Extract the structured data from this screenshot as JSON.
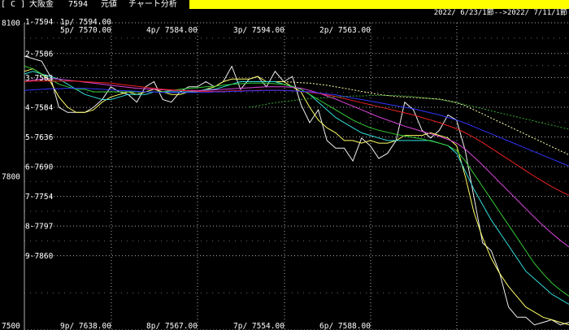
{
  "header": {
    "label_tag": "[ C ]",
    "market": "大阪金",
    "code": "7594",
    "price_type": "元値",
    "menu": "チャート分析"
  },
  "range_text": "2022/ 6/23/1節-->2022/ 7/11/1節",
  "colors": {
    "background": "#000000",
    "grid": "#b0b0b0",
    "highlight": "#ffff00",
    "text": "#ffffff"
  },
  "chart_data": {
    "type": "line",
    "x_count": 64,
    "ylim": [
      7500,
      8100
    ],
    "y_outer_labels": [
      {
        "label": "8100",
        "y": 8100
      },
      {
        "label": "7800",
        "y": 7800
      },
      {
        "label": "7500",
        "y": 7500
      }
    ],
    "y_inner_labels": [
      {
        "label": "1-7594",
        "y": 8100
      },
      {
        "label": "2-7586",
        "y": 8040
      },
      {
        "label": "3-7583",
        "y": 7993
      },
      {
        "label": "4-7584",
        "y": 7935
      },
      {
        "label": "5-7636",
        "y": 7877
      },
      {
        "label": "6-7690",
        "y": 7819
      },
      {
        "label": "7-7754",
        "y": 7761
      },
      {
        "label": "8-7797",
        "y": 7703
      },
      {
        "label": "9-7860",
        "y": 7645
      }
    ],
    "top_annotations": [
      {
        "label": "1p/ 7594.00",
        "row": 0,
        "col": 0
      },
      {
        "label": "5p/ 7570.00",
        "row": 1,
        "col": 0
      },
      {
        "label": "4p/ 7584.00",
        "row": 1,
        "col": 1
      },
      {
        "label": "3p/ 7594.00",
        "row": 1,
        "col": 2
      },
      {
        "label": "2p/ 7563.00",
        "row": 1,
        "col": 3
      }
    ],
    "bottom_annotations": [
      {
        "label": "9p/ 7638.00",
        "col": 0
      },
      {
        "label": "8p/ 7567.00",
        "col": 1
      },
      {
        "label": "7p/ 7554.00",
        "col": 2
      },
      {
        "label": "6p/ 7588.00",
        "col": 3
      }
    ],
    "series": [
      {
        "color": "#f0f0f0",
        "dashed": false,
        "values": [
          8035,
          8030,
          8025,
          7995,
          7935,
          7925,
          7925,
          7925,
          7935,
          7950,
          7975,
          7965,
          7960,
          7945,
          7975,
          7985,
          7950,
          7945,
          7965,
          7975,
          7975,
          7985,
          7975,
          7985,
          8015,
          7970,
          7990,
          7995,
          7975,
          8005,
          7985,
          7995,
          7940,
          7905,
          7930,
          7870,
          7855,
          7855,
          7830,
          7875,
          7860,
          7835,
          7845,
          7870,
          7945,
          7930,
          7890,
          7875,
          7890,
          7920,
          7910,
          7850,
          7760,
          7670,
          7655,
          7610,
          7545,
          7525,
          7525,
          7510,
          7515,
          7520,
          7510,
          7515
        ]
      },
      {
        "color": "#ffff66",
        "dashed": false,
        "values": [
          8005,
          8010,
          8000,
          7985,
          7955,
          7935,
          7925,
          7925,
          7930,
          7945,
          7955,
          7960,
          7965,
          7960,
          7965,
          7970,
          7965,
          7960,
          7960,
          7965,
          7965,
          7970,
          7975,
          7985,
          7990,
          7990,
          7990,
          7995,
          7985,
          7985,
          7985,
          7975,
          7965,
          7935,
          7910,
          7895,
          7885,
          7870,
          7870,
          7865,
          7870,
          7865,
          7865,
          7870,
          7880,
          7880,
          7880,
          7885,
          7880,
          7875,
          7860,
          7800,
          7730,
          7680,
          7640,
          7610,
          7585,
          7565,
          7545,
          7535,
          7525,
          7520,
          7515,
          7510
        ]
      },
      {
        "color": "#33dddd",
        "dashed": false,
        "values": [
          8000,
          8005,
          8000,
          7995,
          7990,
          7980,
          7970,
          7960,
          7955,
          7950,
          7950,
          7955,
          7960,
          7960,
          7960,
          7965,
          7965,
          7965,
          7965,
          7965,
          7965,
          7970,
          7970,
          7975,
          7980,
          7985,
          7985,
          7985,
          7985,
          7985,
          7980,
          7975,
          7970,
          7960,
          7945,
          7930,
          7915,
          7905,
          7895,
          7885,
          7880,
          7875,
          7870,
          7870,
          7870,
          7870,
          7870,
          7870,
          7865,
          7860,
          7845,
          7810,
          7775,
          7745,
          7715,
          7690,
          7665,
          7640,
          7615,
          7600,
          7585,
          7570,
          7560,
          7550
        ]
      },
      {
        "color": "#33cc33",
        "dashed": false,
        "values": [
          8015,
          8010,
          8000,
          7990,
          7980,
          7975,
          7970,
          7970,
          7965,
          7965,
          7965,
          7965,
          7965,
          7965,
          7965,
          7965,
          7965,
          7968,
          7970,
          7972,
          7973,
          7975,
          7976,
          7978,
          7980,
          7981,
          7982,
          7982,
          7982,
          7981,
          7980,
          7976,
          7970,
          7960,
          7950,
          7940,
          7930,
          7920,
          7910,
          7902,
          7895,
          7890,
          7886,
          7882,
          7879,
          7876,
          7873,
          7869,
          7865,
          7860,
          7850,
          7830,
          7805,
          7780,
          7755,
          7730,
          7705,
          7680,
          7655,
          7630,
          7610,
          7592,
          7578,
          7566
        ]
      },
      {
        "color": "#dd44dd",
        "dashed": false,
        "values": [
          7985,
          7988,
          7990,
          7991,
          7990,
          7988,
          7986,
          7984,
          7982,
          7980,
          7978,
          7976,
          7974,
          7972,
          7971,
          7970,
          7969,
          7968,
          7968,
          7968,
          7968,
          7968,
          7969,
          7970,
          7971,
          7972,
          7973,
          7974,
          7975,
          7975,
          7975,
          7974,
          7972,
          7968,
          7963,
          7957,
          7951,
          7944,
          7937,
          7930,
          7923,
          7916,
          7910,
          7904,
          7898,
          7893,
          7888,
          7883,
          7878,
          7872,
          7865,
          7853,
          7838,
          7822,
          7805,
          7788,
          7771,
          7754,
          7737,
          7720,
          7704,
          7689,
          7675,
          7662
        ]
      },
      {
        "color": "#ee2222",
        "dashed": false,
        "values": [
          7985,
          7986,
          7986,
          7986,
          7986,
          7986,
          7986,
          7985,
          7984,
          7983,
          7982,
          7980,
          7978,
          7976,
          7974,
          7972,
          7970,
          7969,
          7968,
          7967,
          7966,
          7966,
          7966,
          7966,
          7967,
          7967,
          7967,
          7968,
          7968,
          7968,
          7968,
          7967,
          7966,
          7964,
          7962,
          7959,
          7956,
          7952,
          7948,
          7944,
          7940,
          7936,
          7932,
          7928,
          7924,
          7920,
          7915,
          7910,
          7905,
          7899,
          7893,
          7885,
          7876,
          7866,
          7855,
          7844,
          7833,
          7822,
          7811,
          7800,
          7790,
          7780,
          7771,
          7763
        ]
      },
      {
        "color": "#3333ff",
        "dashed": false,
        "values": [
          7968,
          7969,
          7970,
          7971,
          7971,
          7972,
          7972,
          7972,
          7971,
          7970,
          7969,
          7968,
          7967,
          7966,
          7965,
          7965,
          7964,
          7964,
          7964,
          7964,
          7964,
          7964,
          7965,
          7965,
          7966,
          7966,
          7967,
          7967,
          7968,
          7968,
          7968,
          7967,
          7966,
          7965,
          7963,
          7961,
          7959,
          7956,
          7953,
          7950,
          7947,
          7944,
          7941,
          7938,
          7935,
          7932,
          7928,
          7924,
          7920,
          7915,
          7910,
          7904,
          7897,
          7890,
          7883,
          7876,
          7869,
          7862,
          7855,
          7848,
          7841,
          7834,
          7827,
          7820
        ]
      },
      {
        "color": "#33aa33",
        "dashed": true,
        "values": [
          null,
          null,
          null,
          null,
          null,
          null,
          null,
          null,
          null,
          null,
          null,
          null,
          null,
          null,
          null,
          null,
          null,
          null,
          null,
          null,
          null,
          null,
          null,
          null,
          null,
          null,
          7935,
          7938,
          7941,
          7944,
          7946,
          7948,
          7950,
          7952,
          7953,
          7954,
          7955,
          7956,
          7957,
          7957,
          7958,
          7958,
          7958,
          7958,
          7957,
          7956,
          7954,
          7952,
          7950,
          7947,
          7944,
          7940,
          7936,
          7932,
          7928,
          7924,
          7920,
          7916,
          7912,
          7908,
          7904,
          7900,
          7896,
          7892
        ]
      },
      {
        "color": "#ffffaa",
        "dashed": true,
        "values": [
          null,
          null,
          null,
          null,
          null,
          null,
          null,
          null,
          null,
          null,
          null,
          null,
          null,
          null,
          null,
          null,
          null,
          null,
          null,
          null,
          null,
          null,
          null,
          null,
          null,
          null,
          null,
          null,
          null,
          null,
          7985,
          7984,
          7983,
          7982,
          7980,
          7978,
          7975,
          7972,
          7969,
          7966,
          7963,
          7960,
          7958,
          7956,
          7955,
          7954,
          7953,
          7952,
          7951,
          7948,
          7944,
          7938,
          7930,
          7922,
          7914,
          7906,
          7898,
          7890,
          7882,
          7874,
          7866,
          7858,
          7850,
          7842
        ]
      }
    ]
  }
}
